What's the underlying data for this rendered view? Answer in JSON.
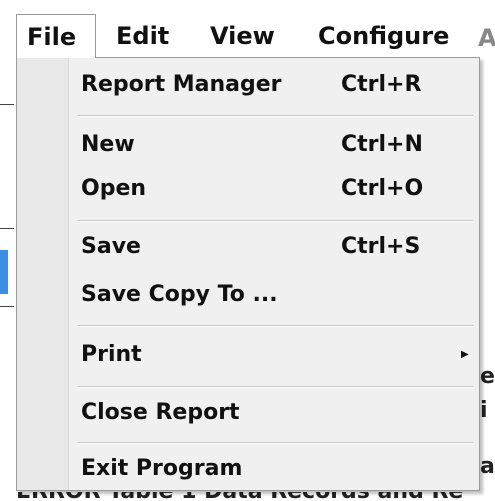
{
  "menubar": {
    "items": [
      {
        "label": "File",
        "active": true
      },
      {
        "label": "Edit"
      },
      {
        "label": "View"
      },
      {
        "label": "Configure"
      }
    ],
    "cut_glyph": "A"
  },
  "background": {
    "right_fragments": [
      "e",
      "i",
      "a"
    ],
    "bottom_fragment": "ERROR  Table 1  Data Records and Re",
    "accent_color": "#3a8ee6"
  },
  "dropdown": {
    "items": [
      {
        "label": "Report Manager",
        "shortcut": "Ctrl+R"
      },
      {
        "label": "New",
        "shortcut": "Ctrl+N"
      },
      {
        "label": "Open",
        "shortcut": "Ctrl+O"
      },
      {
        "label": "Save",
        "shortcut": "Ctrl+S"
      },
      {
        "label": "Save Copy To ...",
        "shortcut": ""
      },
      {
        "label": "Print",
        "shortcut": "",
        "submenu_icon": "submenu-arrow-icon"
      },
      {
        "label": "Close Report",
        "shortcut": ""
      },
      {
        "label": "Exit Program",
        "shortcut": ""
      }
    ]
  }
}
